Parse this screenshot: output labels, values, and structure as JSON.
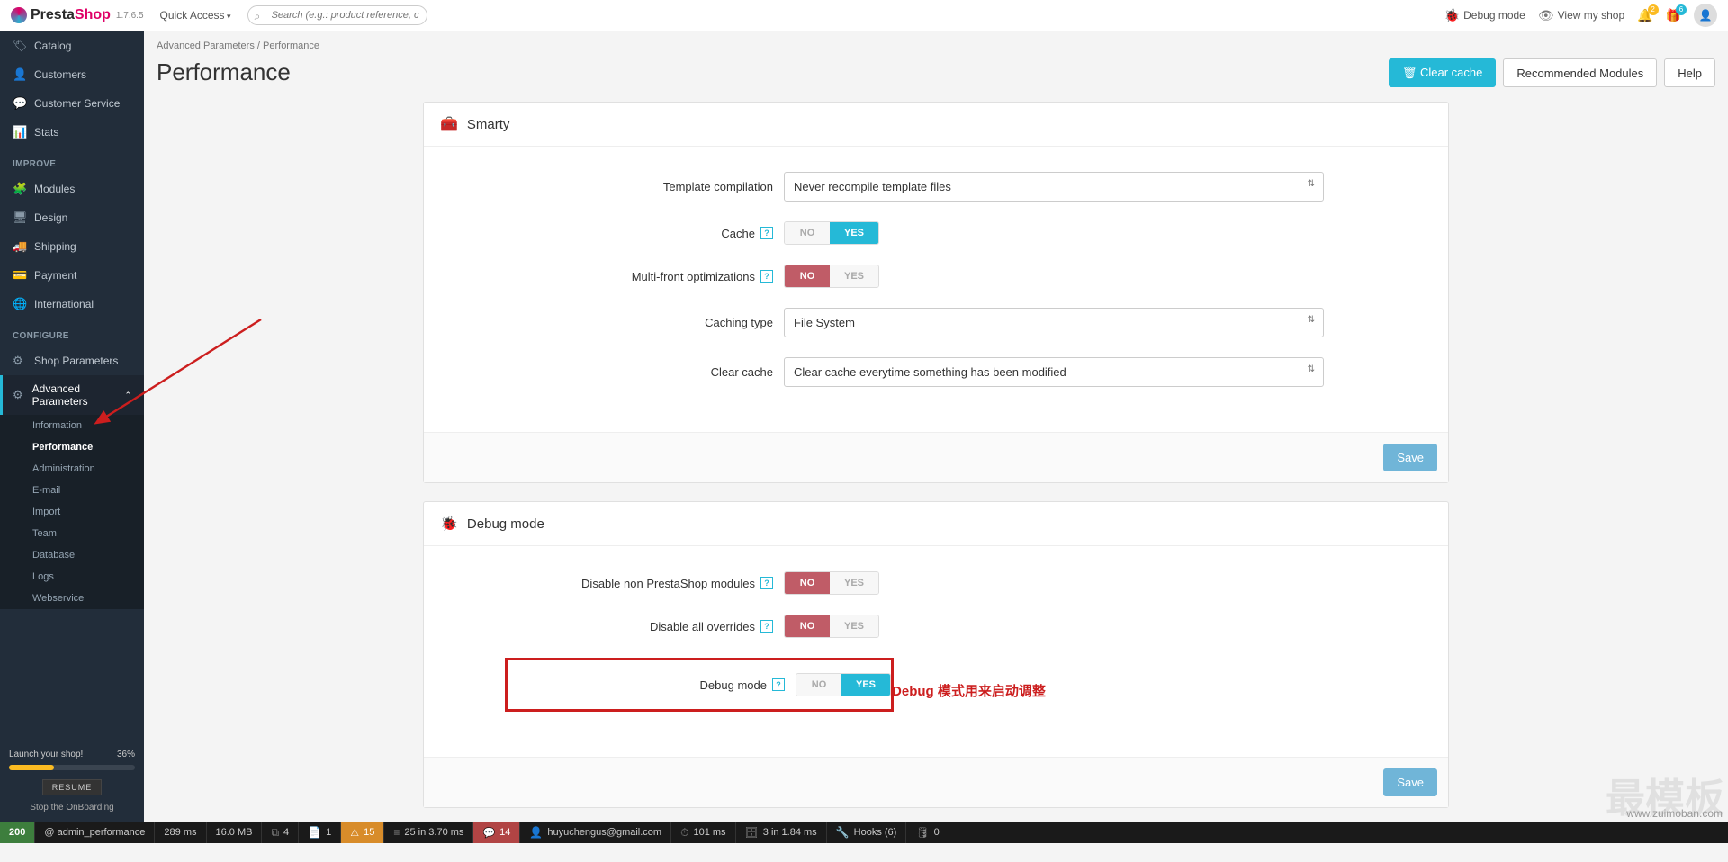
{
  "header": {
    "logo": {
      "presta": "Presta",
      "shop": "Shop"
    },
    "version": "1.7.6.5",
    "quick_access": "Quick Access",
    "search_placeholder": "Search (e.g.: product reference, custome",
    "debug_mode": "Debug mode",
    "view_shop": "View my shop",
    "notif_badge": "2",
    "cart_badge": "6"
  },
  "sidebar": {
    "top_items": [
      {
        "icon": "🏷",
        "label": "Catalog"
      },
      {
        "icon": "👤",
        "label": "Customers"
      },
      {
        "icon": "💬",
        "label": "Customer Service"
      },
      {
        "icon": "📊",
        "label": "Stats"
      }
    ],
    "section_improve": "IMPROVE",
    "improve_items": [
      {
        "icon": "🧩",
        "label": "Modules"
      },
      {
        "icon": "🖥",
        "label": "Design"
      },
      {
        "icon": "🚚",
        "label": "Shipping"
      },
      {
        "icon": "💳",
        "label": "Payment"
      },
      {
        "icon": "🌐",
        "label": "International"
      }
    ],
    "section_configure": "CONFIGURE",
    "configure_items": [
      {
        "icon": "⚙",
        "label": "Shop Parameters"
      },
      {
        "icon": "⚙",
        "label": "Advanced Parameters",
        "active": true
      }
    ],
    "sub_items": [
      "Information",
      "Performance",
      "Administration",
      "E-mail",
      "Import",
      "Team",
      "Database",
      "Logs",
      "Webservice"
    ],
    "sub_active": "Performance",
    "launch_label": "Launch your shop!",
    "launch_pct": "36%",
    "resume": "RESUME",
    "stop": "Stop the OnBoarding"
  },
  "page": {
    "breadcrumb": [
      "Advanced Parameters",
      "Performance"
    ],
    "title": "Performance",
    "btn_clear": "Clear cache",
    "btn_recommended": "Recommended Modules",
    "btn_help": "Help"
  },
  "smarty": {
    "title": "Smarty",
    "fields": {
      "template_compilation": "Template compilation",
      "template_compilation_value": "Never recompile template files",
      "cache": "Cache",
      "multi_front": "Multi-front optimizations",
      "caching_type": "Caching type",
      "caching_type_value": "File System",
      "clear_cache": "Clear cache",
      "clear_cache_value": "Clear cache everytime something has been modified"
    },
    "save": "Save"
  },
  "debug": {
    "title": "Debug mode",
    "fields": {
      "disable_non_ps": "Disable non PrestaShop modules",
      "disable_overrides": "Disable all overrides",
      "debug_mode": "Debug mode"
    },
    "annotation": "Debug 模式用来启动调整",
    "save": "Save"
  },
  "toggle": {
    "no": "NO",
    "yes": "YES"
  },
  "debugbar": {
    "status": "200",
    "route": "@ admin_performance",
    "time": "289 ms",
    "memory": "16.0 MB",
    "forms": "4",
    "docs": "1",
    "warnings": "15",
    "db": "25 in 3.70 ms",
    "msgs": "14",
    "user": "huyuchengus@gmail.com",
    "timing": "101 ms",
    "cache": "3 in 1.84 ms",
    "hooks": "Hooks (6)",
    "zero": "0"
  },
  "site_url": "www.zuimoban.com",
  "watermark": "最模板"
}
